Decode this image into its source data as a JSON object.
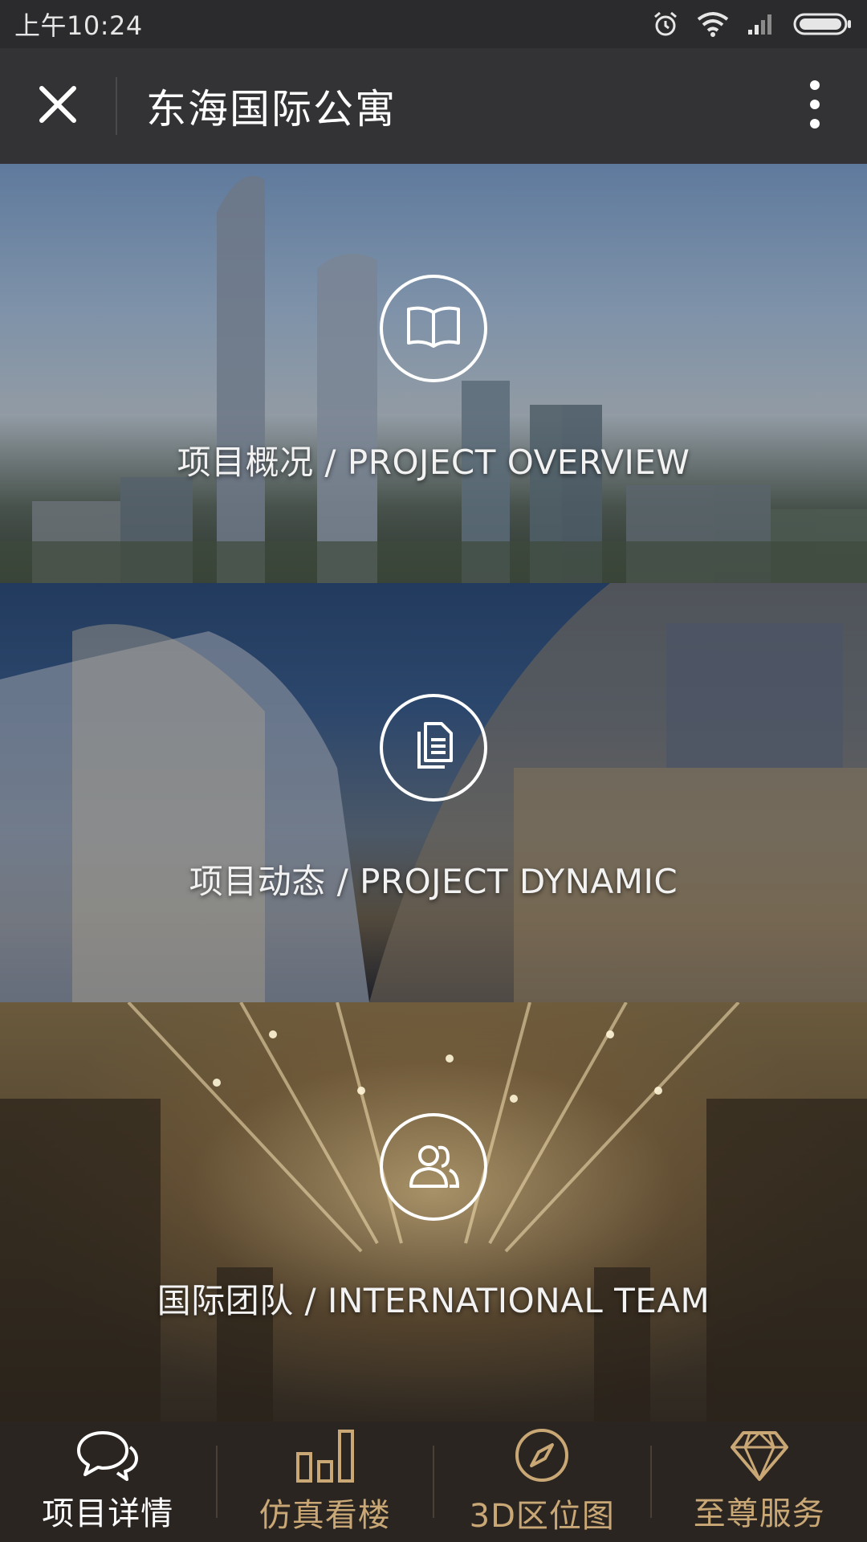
{
  "status_bar": {
    "time": "上午10:24",
    "icons": [
      "alarm-icon",
      "wifi-icon",
      "signal-icon",
      "battery-icon"
    ]
  },
  "title_bar": {
    "title": "东海国际公寓",
    "close_icon": "close-icon",
    "more_icon": "more-vertical-icon"
  },
  "panels": [
    {
      "icon": "book-icon",
      "caption": "项目概况 / PROJECT OVERVIEW"
    },
    {
      "icon": "document-icon",
      "caption": "项目动态 / PROJECT DYNAMIC"
    },
    {
      "icon": "team-icon",
      "caption": "国际团队 / INTERNATIONAL TEAM"
    }
  ],
  "tabs": [
    {
      "label": "项目详情",
      "icon": "chat-icon",
      "active": true
    },
    {
      "label": "仿真看楼",
      "icon": "bar-chart-icon",
      "active": false
    },
    {
      "label": "3D区位图",
      "icon": "compass-icon",
      "active": false
    },
    {
      "label": "至尊服务",
      "icon": "diamond-icon",
      "active": false
    }
  ],
  "colors": {
    "accent_gold": "#c9a876",
    "title_bar_bg": "#333336",
    "tab_bar_bg": "#2b2522"
  }
}
